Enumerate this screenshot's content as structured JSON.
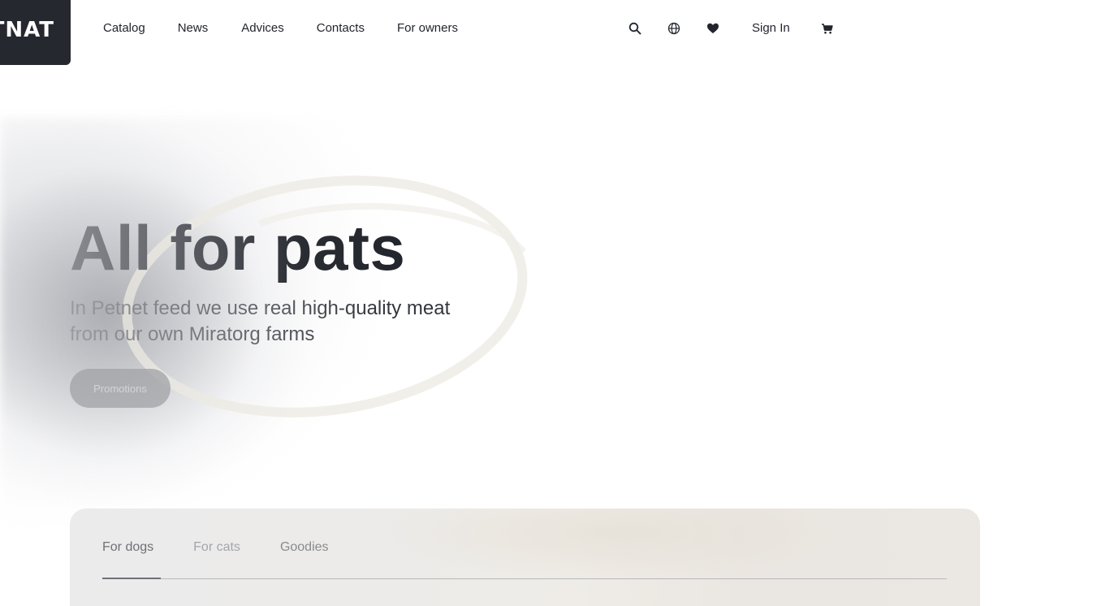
{
  "header": {
    "logo_text": "TNAT",
    "nav": [
      "Catalog",
      "News",
      "Advices",
      "Contacts",
      "For owners"
    ],
    "icons": [
      "search-icon",
      "globe-icon",
      "heart-icon",
      "cart-icon"
    ],
    "sign_in_label": "Sign In"
  },
  "hero": {
    "title": "All for pats",
    "subtitle": "In Petnet feed we use real high-quality meat from our own Miratorg farms",
    "button_label": "Promotions"
  },
  "categories": {
    "tabs": [
      "For dogs",
      "For cats",
      "Goodies"
    ],
    "active_tab": "For dogs"
  },
  "colors": {
    "dark": "#26282f",
    "text": "#22252d",
    "muted": "#a4a5aa"
  }
}
